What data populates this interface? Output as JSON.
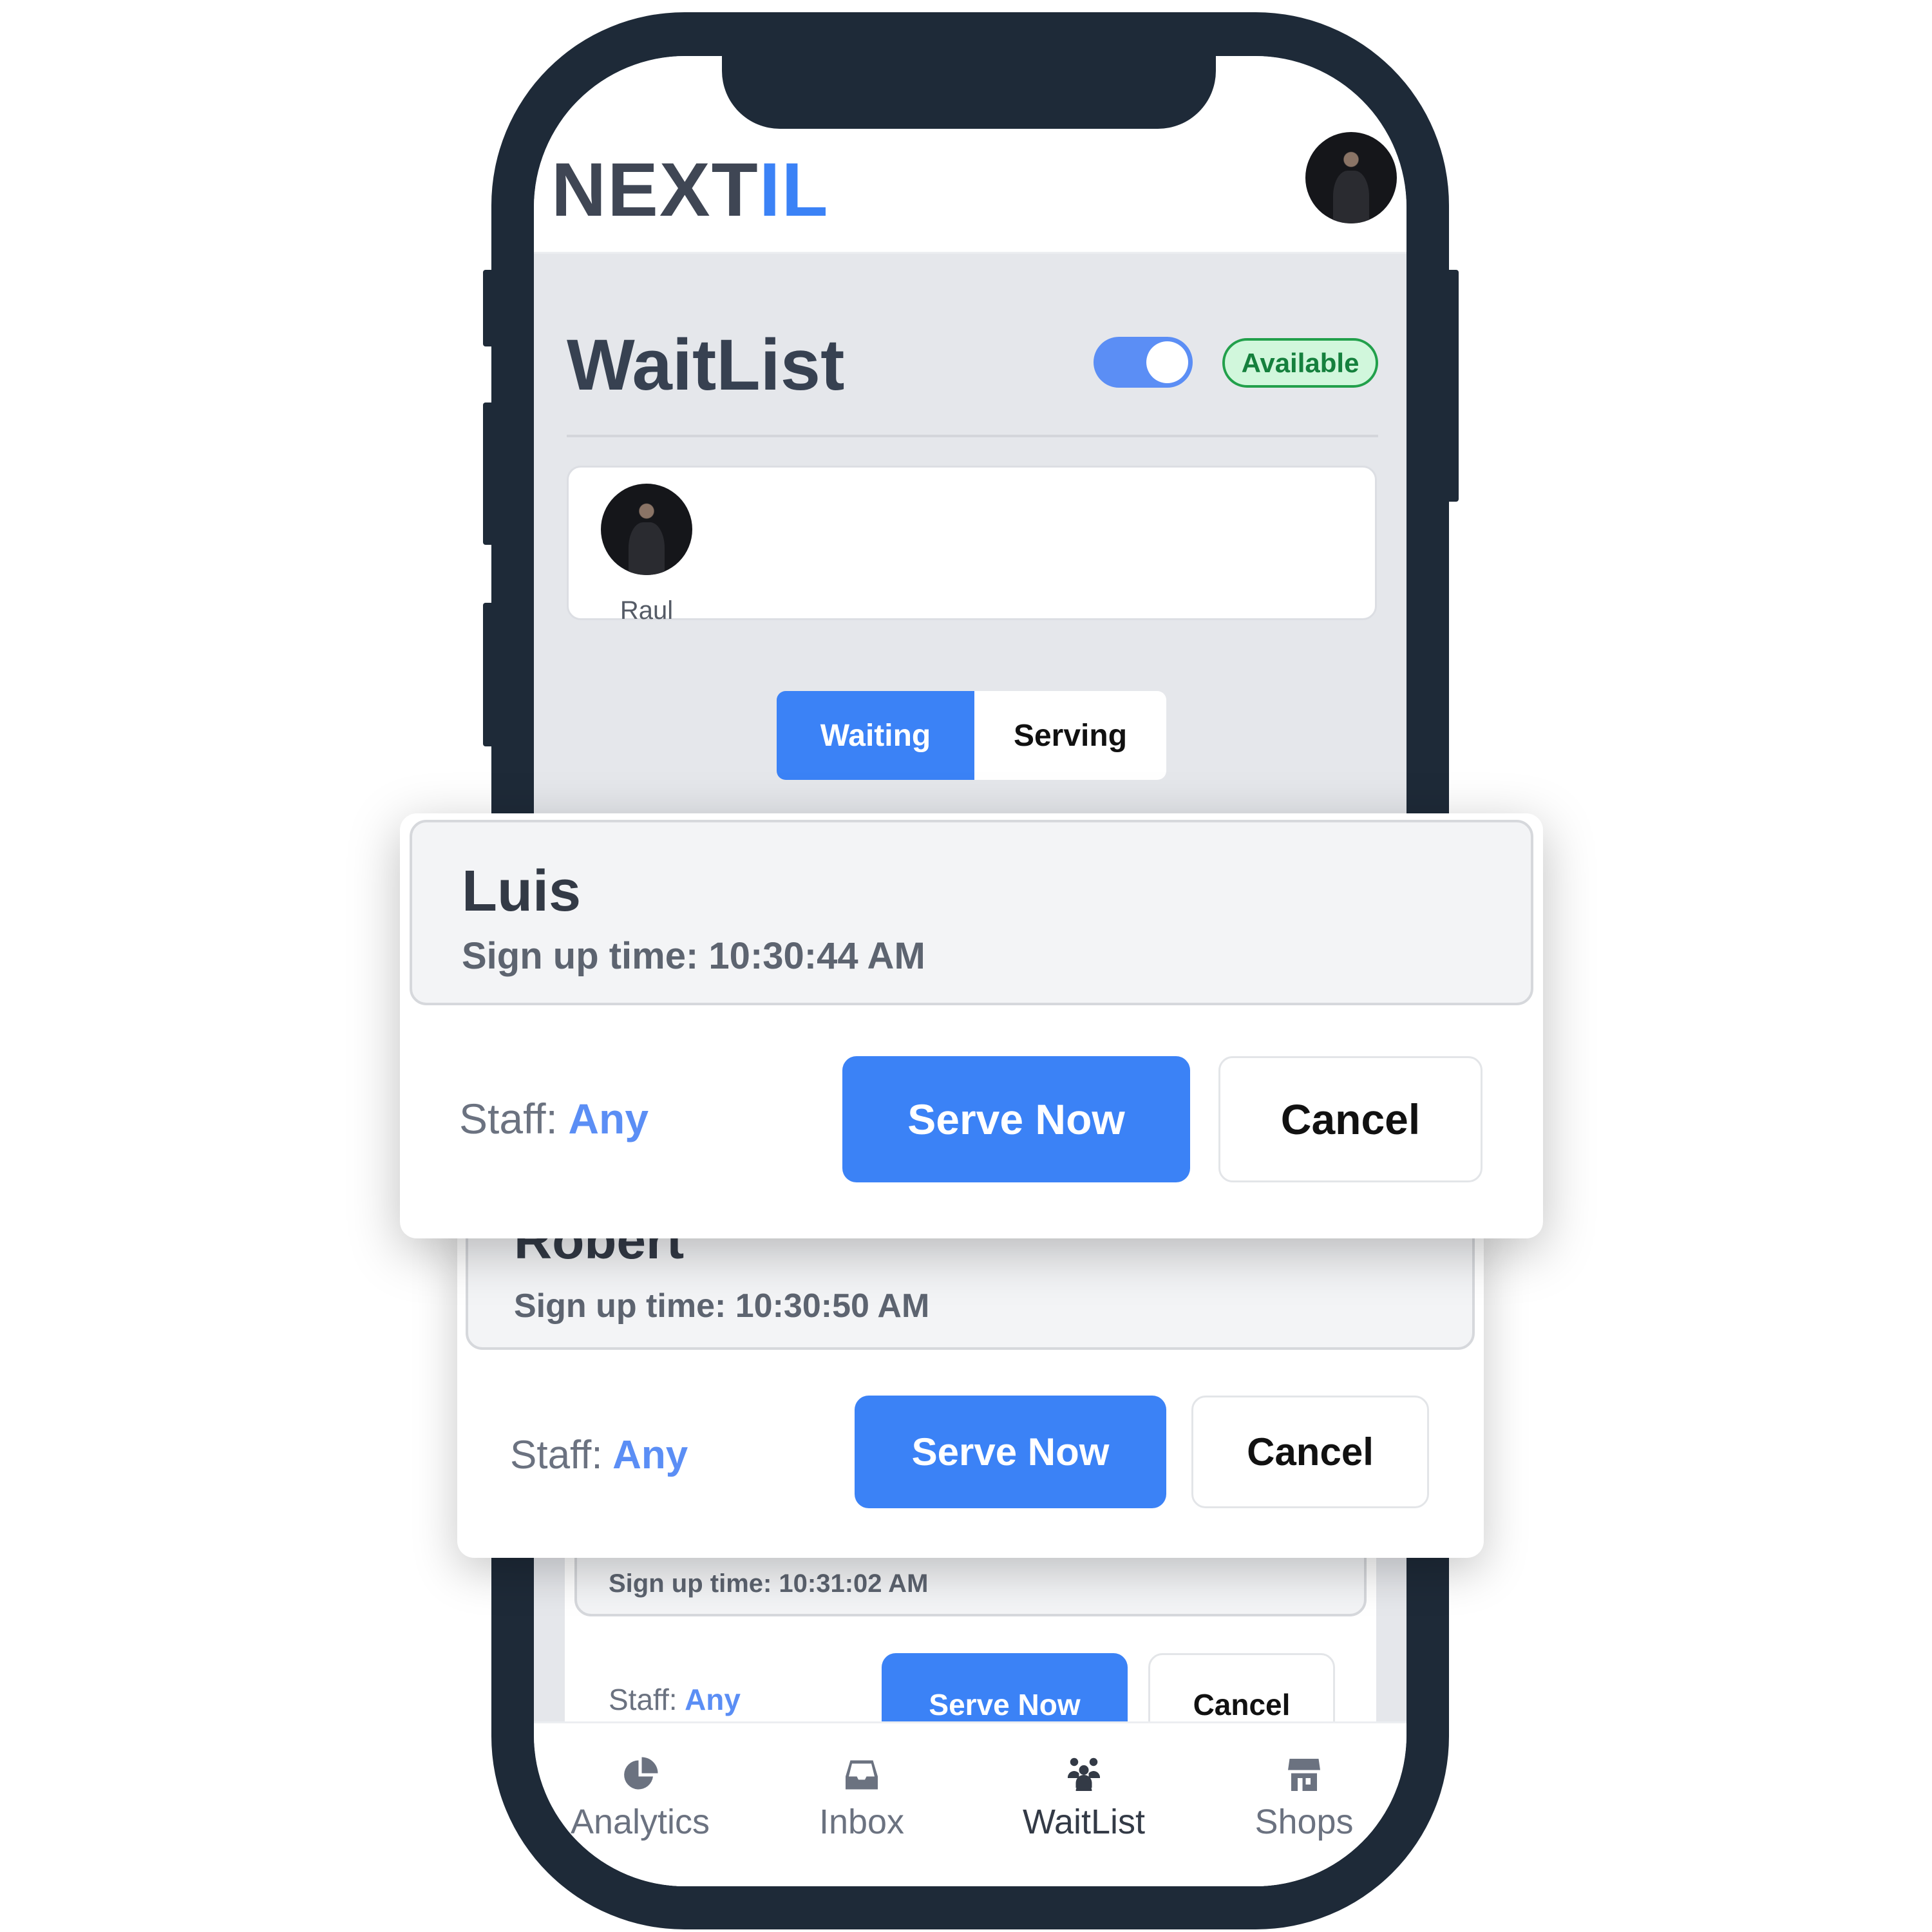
{
  "header": {
    "logo_part1": "NEXT",
    "logo_part2": "IL",
    "avatar_icon": "user-avatar"
  },
  "page": {
    "title": "WaitList",
    "availability_toggle_on": true,
    "status_badge": "Available"
  },
  "staff_selector": {
    "staff": [
      {
        "name": "Raul"
      }
    ]
  },
  "tabs": [
    {
      "label": "Waiting",
      "active": true
    },
    {
      "label": "Serving",
      "active": false
    }
  ],
  "queue": [
    {
      "name": "Luis",
      "signup": "Sign up time: 10:30:44 AM",
      "staff_label": "Staff:",
      "staff_value": "Any",
      "serve_label": "Serve Now",
      "cancel_label": "Cancel"
    },
    {
      "name": "Robert",
      "signup": "Sign up time: 10:30:50 AM",
      "staff_label": "Staff:",
      "staff_value": "Any",
      "serve_label": "Serve Now",
      "cancel_label": "Cancel"
    },
    {
      "signup": "Sign up time: 10:31:02 AM",
      "staff_label": "Staff:",
      "staff_value": "Any",
      "serve_label": "Serve Now",
      "cancel_label": "Cancel"
    }
  ],
  "bottom_nav": [
    {
      "label": "Analytics",
      "icon": "pie-chart-icon",
      "active": false
    },
    {
      "label": "Inbox",
      "icon": "inbox-icon",
      "active": false
    },
    {
      "label": "WaitList",
      "icon": "users-icon",
      "active": true
    },
    {
      "label": "Shops",
      "icon": "store-icon",
      "active": false
    }
  ],
  "colors": {
    "accent": "#3b82f6",
    "frame": "#1e2a38",
    "available": "#15803d",
    "background": "#e5e7eb"
  }
}
